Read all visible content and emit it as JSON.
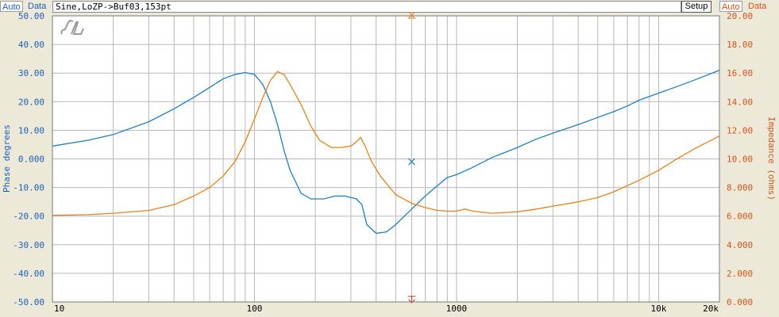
{
  "toolbar": {
    "left_auto": "Auto",
    "left_data": "Data",
    "right_auto": "Auto",
    "right_data": "Data",
    "setup": "Setup"
  },
  "title": "Sine,LoZP->Buf03,153pt",
  "logo_text": "SL",
  "colors": {
    "phase": "#1f7fc4",
    "impedance": "#e8821a",
    "left_axis": "#1f5fbf",
    "right_axis": "#d9541a",
    "grid": "#b8b8b8",
    "plot_bg": "#ffffff"
  },
  "chart_data": {
    "type": "line",
    "xscale": "log",
    "xlim": [
      10,
      20000
    ],
    "xticks": [
      10,
      100,
      1000,
      10000,
      20000
    ],
    "xtick_labels": [
      "10",
      "100",
      "1000",
      "10k",
      "20k"
    ],
    "ylabel_left": "Phase degrees",
    "ylim_left": [
      -50,
      50
    ],
    "yticks_left": [
      "-50.00",
      "-40.00",
      "-30.00",
      "-20.00",
      "-10.00",
      "0.000",
      "10.00",
      "20.00",
      "30.00",
      "40.00",
      "50.00"
    ],
    "ylabel_right": "Impedance (ohms)",
    "ylim_right": [
      0,
      20
    ],
    "yticks_right": [
      "0.000",
      "2.000",
      "4.000",
      "6.000",
      "8.000",
      "10.00",
      "12.00",
      "14.00",
      "16.00",
      "18.00",
      "20.00"
    ],
    "grid": true,
    "cursor_x": 600,
    "cursor_marker_value": -1,
    "series": [
      {
        "axis": "left",
        "color": "#1f7fc4",
        "points": [
          [
            10,
            4.5
          ],
          [
            15,
            6.5
          ],
          [
            20,
            8.5
          ],
          [
            30,
            13
          ],
          [
            40,
            17.5
          ],
          [
            50,
            21.5
          ],
          [
            60,
            25
          ],
          [
            70,
            28
          ],
          [
            80,
            29.5
          ],
          [
            90,
            30.2
          ],
          [
            100,
            29.5
          ],
          [
            110,
            26
          ],
          [
            120,
            20
          ],
          [
            130,
            12
          ],
          [
            140,
            3
          ],
          [
            150,
            -4
          ],
          [
            170,
            -12
          ],
          [
            190,
            -14
          ],
          [
            220,
            -14
          ],
          [
            250,
            -13
          ],
          [
            280,
            -13
          ],
          [
            320,
            -14
          ],
          [
            340,
            -16
          ],
          [
            360,
            -23
          ],
          [
            400,
            -26
          ],
          [
            450,
            -25.5
          ],
          [
            500,
            -23
          ],
          [
            600,
            -17.5
          ],
          [
            700,
            -13
          ],
          [
            800,
            -9.5
          ],
          [
            900,
            -6.5
          ],
          [
            1000,
            -5.5
          ],
          [
            1200,
            -3
          ],
          [
            1500,
            0.5
          ],
          [
            2000,
            4
          ],
          [
            2500,
            7
          ],
          [
            3000,
            9
          ],
          [
            4000,
            12
          ],
          [
            5000,
            14.5
          ],
          [
            6000,
            16.5
          ],
          [
            7000,
            18.5
          ],
          [
            8000,
            20.5
          ],
          [
            10000,
            23
          ],
          [
            12000,
            25
          ],
          [
            15000,
            27.5
          ],
          [
            20000,
            31
          ]
        ]
      },
      {
        "axis": "right",
        "color": "#e8821a",
        "points": [
          [
            10,
            6.05
          ],
          [
            15,
            6.1
          ],
          [
            20,
            6.2
          ],
          [
            30,
            6.4
          ],
          [
            40,
            6.8
          ],
          [
            50,
            7.4
          ],
          [
            60,
            8.0
          ],
          [
            70,
            8.8
          ],
          [
            80,
            9.8
          ],
          [
            90,
            11.2
          ],
          [
            100,
            12.8
          ],
          [
            110,
            14.3
          ],
          [
            120,
            15.5
          ],
          [
            130,
            16.1
          ],
          [
            140,
            15.9
          ],
          [
            150,
            15.2
          ],
          [
            170,
            13.8
          ],
          [
            190,
            12.3
          ],
          [
            210,
            11.3
          ],
          [
            240,
            10.8
          ],
          [
            270,
            10.8
          ],
          [
            300,
            10.9
          ],
          [
            320,
            11.2
          ],
          [
            335,
            11.5
          ],
          [
            350,
            11.0
          ],
          [
            380,
            9.8
          ],
          [
            420,
            8.8
          ],
          [
            500,
            7.5
          ],
          [
            600,
            6.9
          ],
          [
            700,
            6.6
          ],
          [
            800,
            6.4
          ],
          [
            900,
            6.35
          ],
          [
            1000,
            6.35
          ],
          [
            1100,
            6.5
          ],
          [
            1200,
            6.35
          ],
          [
            1500,
            6.2
          ],
          [
            2000,
            6.3
          ],
          [
            2500,
            6.5
          ],
          [
            3000,
            6.7
          ],
          [
            4000,
            7.0
          ],
          [
            5000,
            7.3
          ],
          [
            6000,
            7.7
          ],
          [
            8000,
            8.5
          ],
          [
            10000,
            9.2
          ],
          [
            12000,
            9.9
          ],
          [
            15000,
            10.7
          ],
          [
            20000,
            11.6
          ]
        ]
      }
    ]
  }
}
